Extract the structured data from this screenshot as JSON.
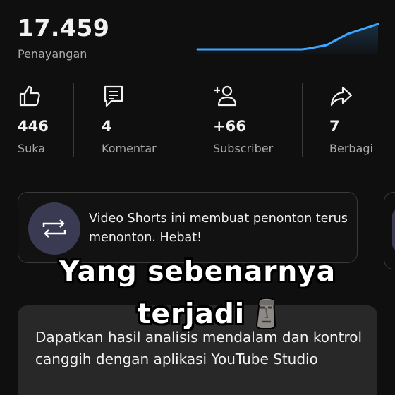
{
  "summary": {
    "views_value": "17.459",
    "views_label": "Penayangan"
  },
  "stats": [
    {
      "icon": "thumbs-up-icon",
      "value": "446",
      "label": "Suka"
    },
    {
      "icon": "comment-icon",
      "value": "4",
      "label": "Komentar"
    },
    {
      "icon": "add-person-icon",
      "value": "+66",
      "label": "Subscriber"
    },
    {
      "icon": "share-icon",
      "value": "7",
      "label": "Berbagi"
    }
  ],
  "insight": {
    "icon": "repeat-icon",
    "text": "Video Shorts ini membuat penonton terus menonton. Hebat!"
  },
  "studio_promo": {
    "text": "Dapatkan hasil analisis mendalam dan kontrol canggih dengan aplikasi YouTube Studio"
  },
  "overlay_caption": {
    "line1": "Yang sebenarnya",
    "line2": "terjadi",
    "emoji": "moai-emoji"
  },
  "colors": {
    "background": "#0f0f0f",
    "trend_line": "#3ea6ff",
    "secondary_text": "#aaaaaa"
  }
}
